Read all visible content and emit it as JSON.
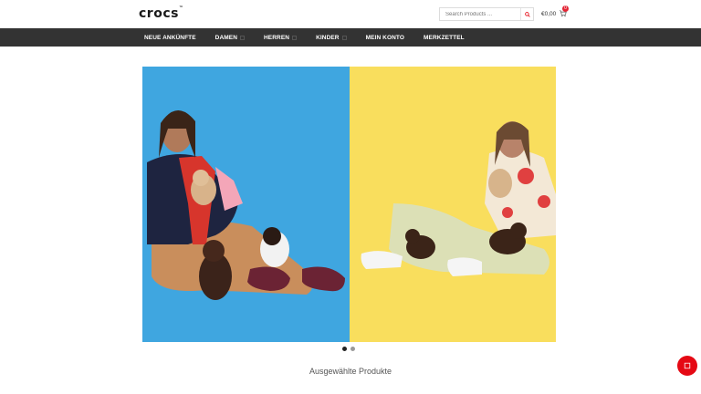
{
  "brand": {
    "logo_text": "crocs",
    "logo_mark": "™"
  },
  "search": {
    "placeholder": "Search Products ..."
  },
  "cart": {
    "total": "€0,00",
    "count": "0"
  },
  "nav": {
    "items": [
      {
        "label": "NEUE ANKÜNFTE",
        "has_dropdown": false
      },
      {
        "label": "DAMEN",
        "has_dropdown": true
      },
      {
        "label": "HERREN",
        "has_dropdown": true
      },
      {
        "label": "KINDER",
        "has_dropdown": true
      },
      {
        "label": "MEIN KONTO",
        "has_dropdown": false
      },
      {
        "label": "MERKZETTEL",
        "has_dropdown": false
      }
    ]
  },
  "hero": {
    "slides": 2,
    "active_slide": 1,
    "colors": {
      "left_bg": "#3fa6e0",
      "right_bg": "#f9de5d"
    }
  },
  "featured": {
    "title": "Ausgewählte Produkte"
  },
  "colors": {
    "accent": "#e50914",
    "nav_bg": "#333333"
  }
}
